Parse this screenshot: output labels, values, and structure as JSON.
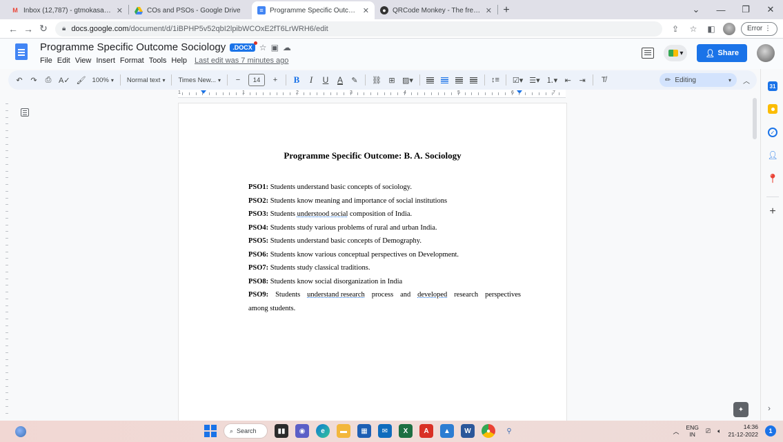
{
  "browser": {
    "tabs": [
      {
        "title": "Inbox (12,787) - gtmokasare@gr",
        "icon": "gmail-icon",
        "active": false
      },
      {
        "title": "COs and PSOs - Google Drive",
        "icon": "drive-icon",
        "active": false
      },
      {
        "title": "Programme Specific Outcome So",
        "icon": "docs-icon",
        "active": true
      },
      {
        "title": "QRCode Monkey - The free QR C",
        "icon": "qrcode-monkey-icon",
        "active": false
      }
    ],
    "url_domain": "docs.google.com",
    "url_path": "/document/d/1iBPHP5v52qbI2lpibWCOxE2fT6LrWRH6/edit",
    "error_label": "Error"
  },
  "docs": {
    "title": "Programme Specific Outcome Sociology",
    "badge": ".DOCX",
    "menu": [
      "File",
      "Edit",
      "View",
      "Insert",
      "Format",
      "Tools",
      "Help"
    ],
    "last_edit": "Last edit was 7 minutes ago",
    "share_label": "Share"
  },
  "toolbar": {
    "zoom": "100%",
    "style": "Normal text",
    "font": "Times New...",
    "font_size": "14",
    "mode": "Editing"
  },
  "ruler": {
    "numbers": [
      "1",
      "1",
      "2",
      "3",
      "4",
      "5",
      "6",
      "7"
    ]
  },
  "document": {
    "heading": "Programme Specific Outcome: B. A. Sociology",
    "items": [
      {
        "label": "PSO1:",
        "text": " Students understand basic concepts of sociology."
      },
      {
        "label": "PSO2:",
        "text": " Students know meaning and importance of social institutions"
      },
      {
        "label": "PSO3:",
        "text_before": " Students ",
        "flagged": "understood social",
        "text_after": " composition of India."
      },
      {
        "label": "PSO4:",
        "text": " Students study various problems of rural and urban India."
      },
      {
        "label": "PSO5:",
        "text": " Students understand basic concepts of Demography."
      },
      {
        "label": "PSO6:",
        "text": " Students know various conceptual perspectives on Development."
      },
      {
        "label": "PSO7:",
        "text": " Students study classical traditions."
      },
      {
        "label": "PSO8:",
        "text": " Students know social disorganization in India"
      }
    ],
    "pso9": {
      "label": "PSO9:",
      "words": [
        "Students",
        "understand research",
        "process",
        "and",
        "developed",
        "research",
        "perspectives"
      ],
      "continuation": "among students."
    }
  },
  "taskbar": {
    "search_label": "Search",
    "lang_top": "ENG",
    "lang_bottom": "IN",
    "time": "14:36",
    "date": "21-12-2022",
    "notification_count": "1"
  }
}
